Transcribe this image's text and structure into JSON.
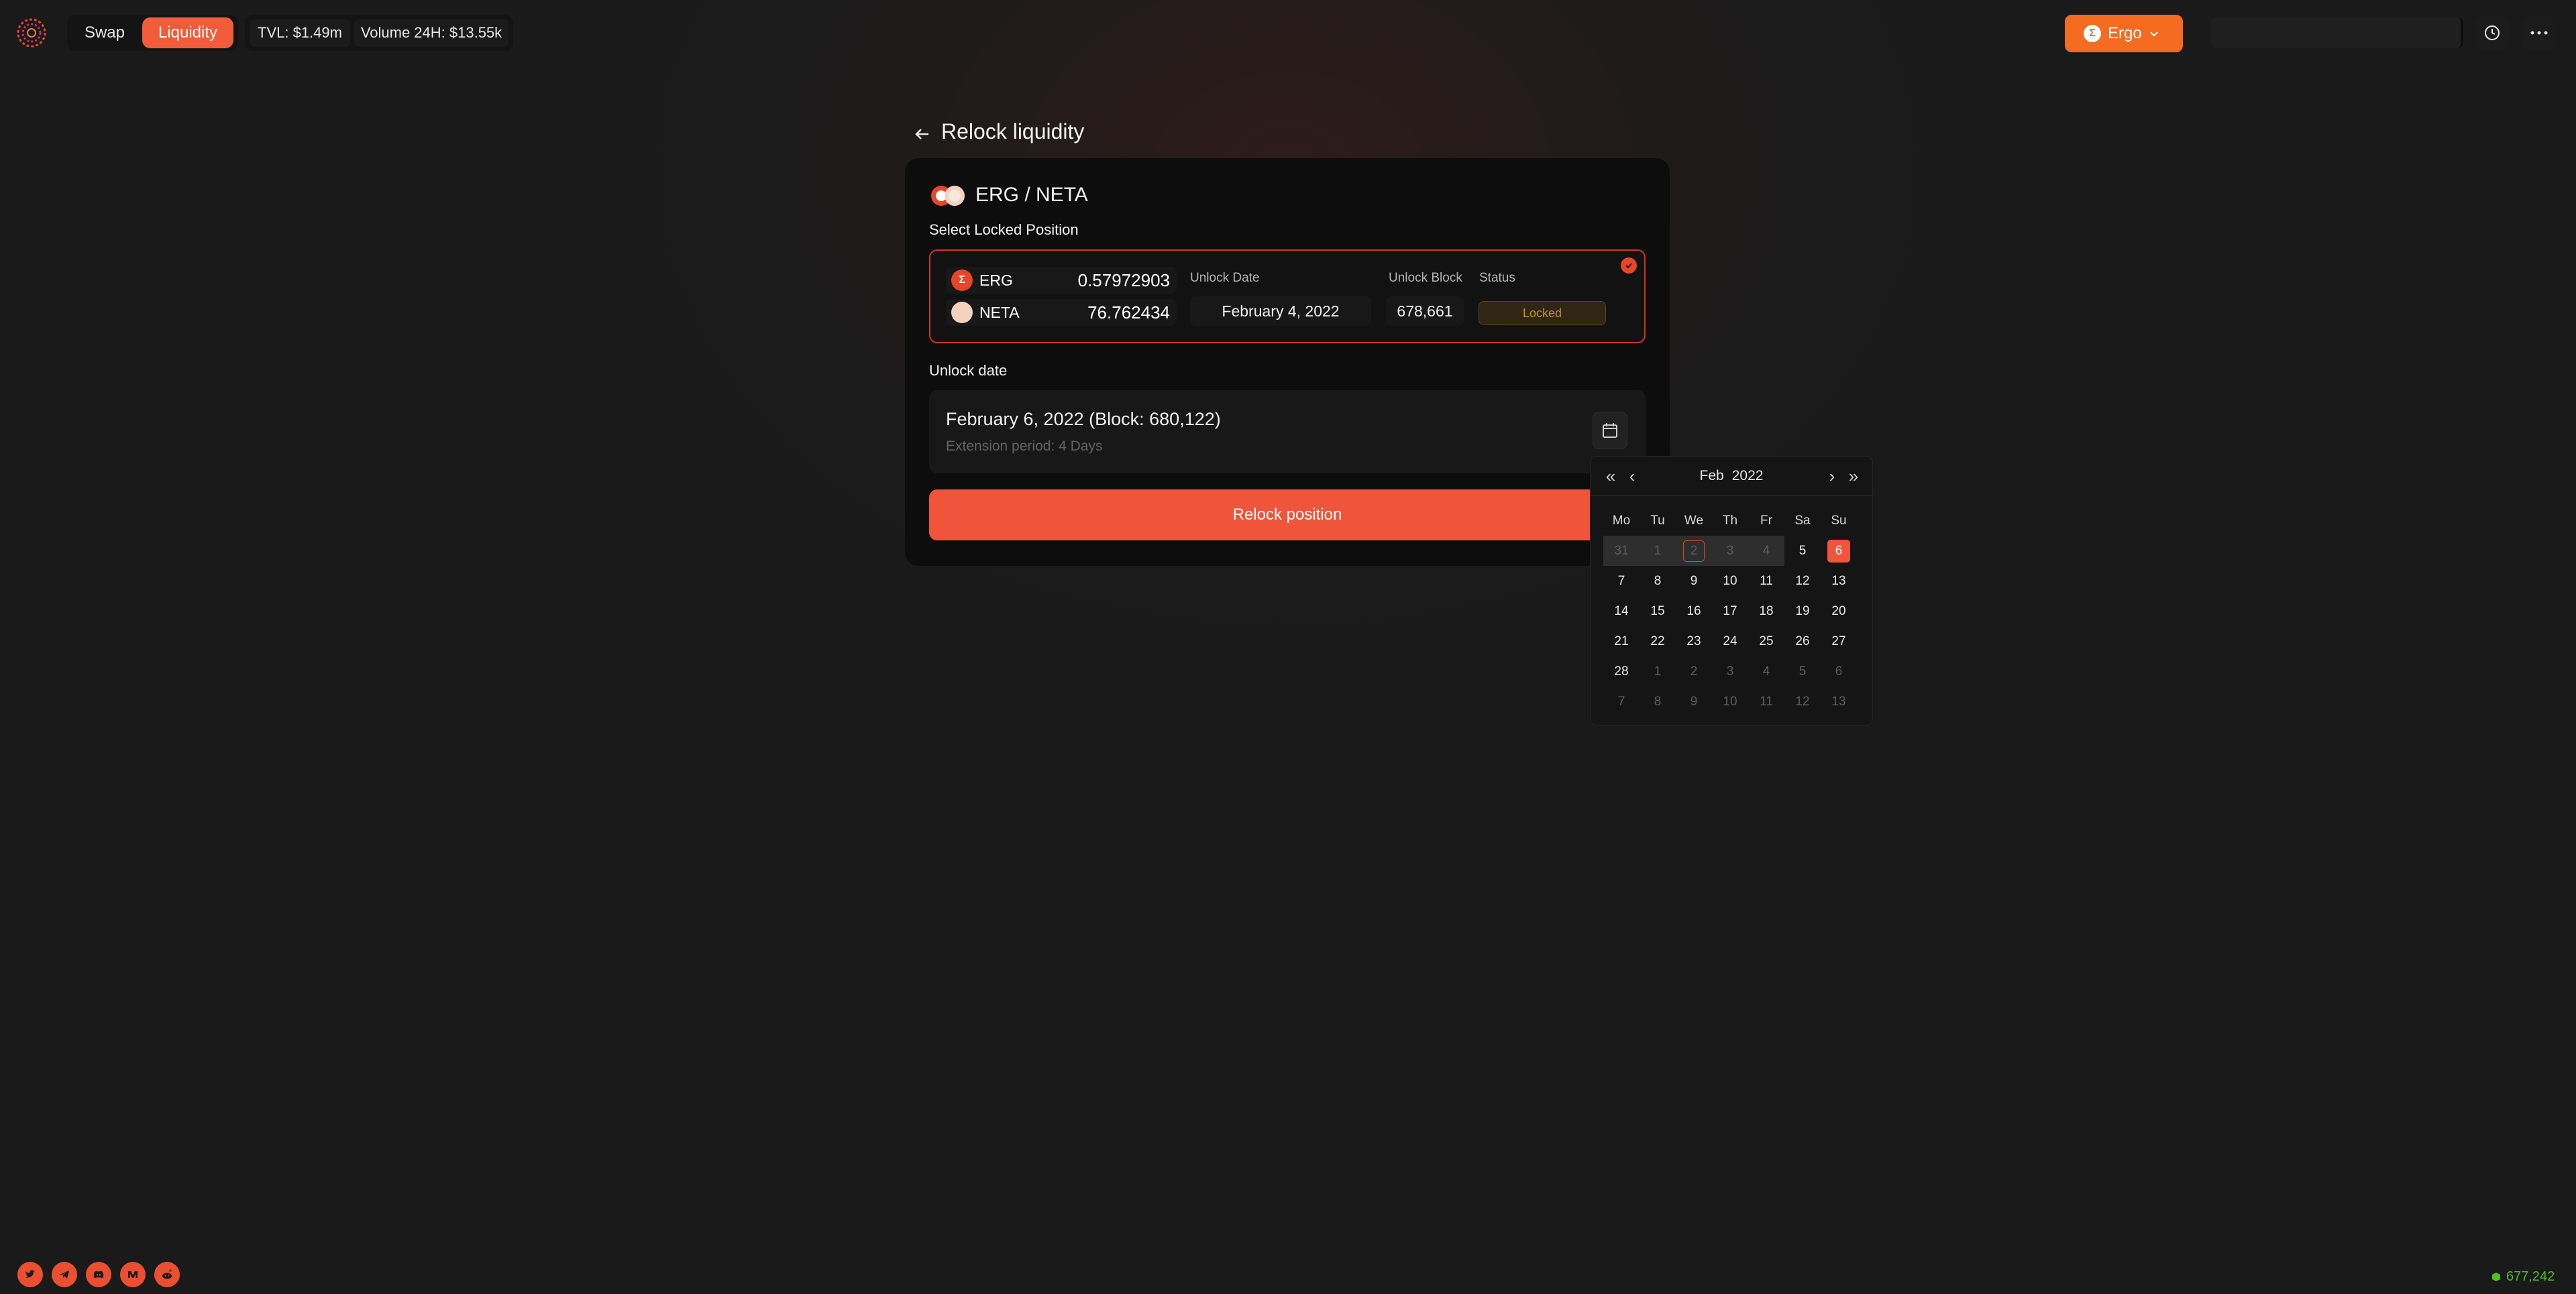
{
  "header": {
    "nav": {
      "swap_label": "Swap",
      "liquidity_label": "Liquidity"
    },
    "stats": {
      "tvl": "TVL: $1.49m",
      "volume": "Volume 24H: $13.55k"
    },
    "network": {
      "label": "Ergo",
      "icon": "ergo-icon"
    },
    "colors": {
      "accent": "#f25c3a",
      "network": "#f56b1f"
    }
  },
  "page": {
    "title": "Relock liquidity"
  },
  "card": {
    "pair": "ERG / NETA",
    "select_label": "Select Locked Position",
    "position": {
      "tokens": [
        {
          "symbol": "ERG",
          "amount": "0.57972903"
        },
        {
          "symbol": "NETA",
          "amount": "76.762434"
        }
      ],
      "unlock_date_label": "Unlock Date",
      "unlock_date": "February 4, 2022",
      "unlock_block_label": "Unlock Block",
      "unlock_block": "678,661",
      "status_label": "Status",
      "status": "Locked"
    },
    "unlock_section_label": "Unlock date",
    "unlock_value": "February 6, 2022 (Block: 680,122)",
    "extension_period": "Extension period: 4 Days",
    "relock_button": "Relock position"
  },
  "calendar": {
    "month": "Feb",
    "year": "2022",
    "weekdays": [
      "Mo",
      "Tu",
      "We",
      "Th",
      "Fr",
      "Sa",
      "Su"
    ],
    "weeks": [
      [
        "31",
        "1",
        "2",
        "3",
        "4",
        "5",
        "6"
      ],
      [
        "7",
        "8",
        "9",
        "10",
        "11",
        "12",
        "13"
      ],
      [
        "14",
        "15",
        "16",
        "17",
        "18",
        "19",
        "20"
      ],
      [
        "21",
        "22",
        "23",
        "24",
        "25",
        "26",
        "27"
      ],
      [
        "28",
        "1",
        "2",
        "3",
        "4",
        "5",
        "6"
      ],
      [
        "7",
        "8",
        "9",
        "10",
        "11",
        "12",
        "13"
      ]
    ],
    "today": "2",
    "selected": "6"
  },
  "footer": {
    "socials": [
      "twitter-icon",
      "telegram-icon",
      "discord-icon",
      "medium-icon",
      "reddit-icon"
    ],
    "block_height": "677,242"
  }
}
